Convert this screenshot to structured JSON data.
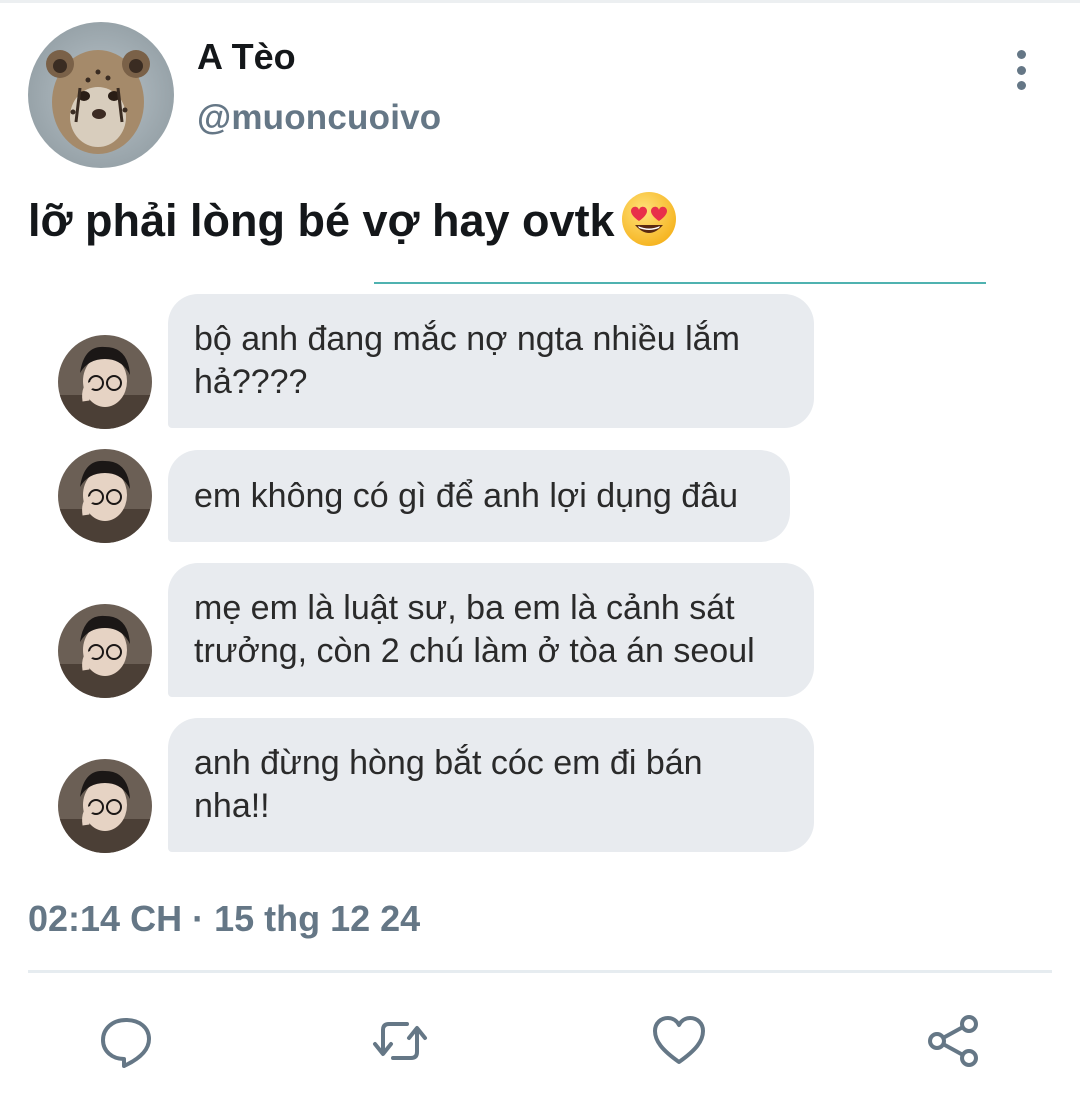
{
  "user": {
    "display_name": "A Tèo",
    "handle": "@muoncuoivo",
    "avatar": "cheetah-cub-avatar"
  },
  "more_icon": "more-vertical-icon",
  "tweet": {
    "text": "lỡ phải lòng bé vợ hay ovtk",
    "emoji": "heart-eyes-emoji",
    "timestamp": "02:14 CH · 15 thg 12 24"
  },
  "chat": {
    "messages": [
      {
        "lines": [
          "bộ anh đang mắc nợ ngta nhiều lắm",
          "hả????"
        ]
      },
      {
        "lines": [
          "em không có gì để anh lợi dụng đâu"
        ]
      },
      {
        "lines": [
          "mẹ em là luật sư, ba em là cảnh sát",
          "trưởng, còn 2 chú làm ở tòa án seoul"
        ]
      },
      {
        "lines": [
          "anh đừng hòng bắt cóc em đi bán",
          "nha!!"
        ]
      }
    ]
  },
  "actions": {
    "reply": "reply-icon",
    "retweet": "retweet-icon",
    "like": "like-heart-icon",
    "share": "share-icon"
  },
  "colors": {
    "text": "#14171a",
    "secondary": "#657786",
    "bubble": "#e8ebef",
    "accent_line": "#4fb2b0"
  }
}
